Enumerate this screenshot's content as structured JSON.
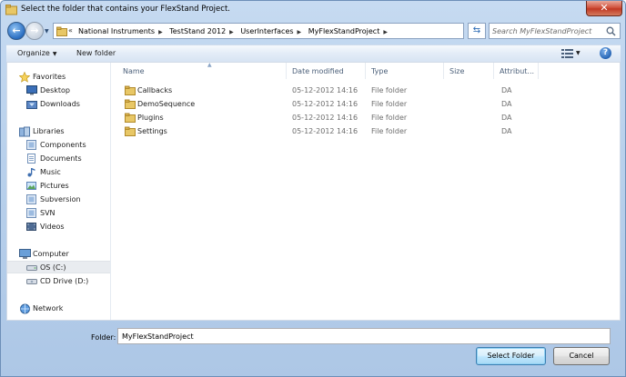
{
  "window": {
    "title": "Select the folder that contains your FlexStand Project."
  },
  "nav": {
    "history_prefix": "«",
    "breadcrumbs": [
      "National Instruments",
      "TestStand 2012",
      "UserInterfaces",
      "MyFlexStandProject"
    ],
    "search_placeholder": "Search MyFlexStandProject"
  },
  "toolbar": {
    "organize_label": "Organize",
    "new_folder_label": "New folder"
  },
  "sidebar": {
    "favorites": {
      "label": "Favorites",
      "items": [
        {
          "label": "Desktop"
        },
        {
          "label": "Downloads"
        }
      ]
    },
    "libraries": {
      "label": "Libraries",
      "items": [
        {
          "label": "Components"
        },
        {
          "label": "Documents"
        },
        {
          "label": "Music"
        },
        {
          "label": "Pictures"
        },
        {
          "label": "Subversion"
        },
        {
          "label": "SVN"
        },
        {
          "label": "Videos"
        }
      ]
    },
    "computer": {
      "label": "Computer",
      "items": [
        {
          "label": "OS (C:)",
          "selected": true
        },
        {
          "label": "CD Drive (D:)"
        }
      ]
    },
    "network": {
      "label": "Network"
    }
  },
  "files": {
    "columns": [
      "Name",
      "Date modified",
      "Type",
      "Size",
      "Attribut..."
    ],
    "rows": [
      {
        "name": "Callbacks",
        "date": "05-12-2012 14:16",
        "type": "File folder",
        "size": "",
        "attr": "DA"
      },
      {
        "name": "DemoSequence",
        "date": "05-12-2012 14:16",
        "type": "File folder",
        "size": "",
        "attr": "DA"
      },
      {
        "name": "Plugins",
        "date": "05-12-2012 14:16",
        "type": "File folder",
        "size": "",
        "attr": "DA"
      },
      {
        "name": "Settings",
        "date": "05-12-2012 14:16",
        "type": "File folder",
        "size": "",
        "attr": "DA"
      }
    ]
  },
  "footer": {
    "folder_label": "Folder:",
    "folder_value": "MyFlexStandProject",
    "select_button": "Select Folder",
    "cancel_button": "Cancel"
  },
  "colors": {
    "frame": "#b9d1ec",
    "folder": "#e8c766",
    "accent": "#3c7fb1",
    "close": "#c13a25"
  }
}
